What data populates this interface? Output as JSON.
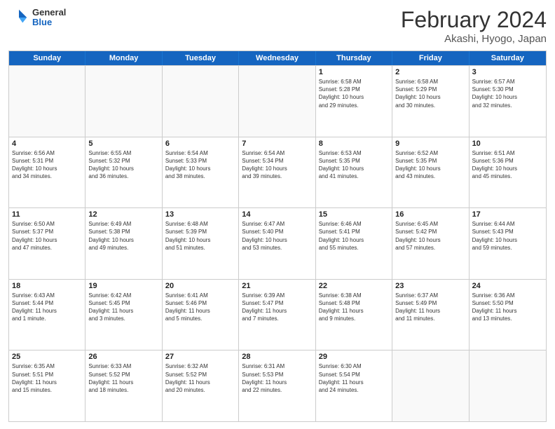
{
  "header": {
    "logo": {
      "general": "General",
      "blue": "Blue"
    },
    "title": "February 2024",
    "location": "Akashi, Hyogo, Japan"
  },
  "days_of_week": [
    "Sunday",
    "Monday",
    "Tuesday",
    "Wednesday",
    "Thursday",
    "Friday",
    "Saturday"
  ],
  "rows": [
    {
      "cells": [
        {
          "day": "",
          "info": ""
        },
        {
          "day": "",
          "info": ""
        },
        {
          "day": "",
          "info": ""
        },
        {
          "day": "",
          "info": ""
        },
        {
          "day": "1",
          "info": "Sunrise: 6:58 AM\nSunset: 5:28 PM\nDaylight: 10 hours\nand 29 minutes."
        },
        {
          "day": "2",
          "info": "Sunrise: 6:58 AM\nSunset: 5:29 PM\nDaylight: 10 hours\nand 30 minutes."
        },
        {
          "day": "3",
          "info": "Sunrise: 6:57 AM\nSunset: 5:30 PM\nDaylight: 10 hours\nand 32 minutes."
        }
      ]
    },
    {
      "cells": [
        {
          "day": "4",
          "info": "Sunrise: 6:56 AM\nSunset: 5:31 PM\nDaylight: 10 hours\nand 34 minutes."
        },
        {
          "day": "5",
          "info": "Sunrise: 6:55 AM\nSunset: 5:32 PM\nDaylight: 10 hours\nand 36 minutes."
        },
        {
          "day": "6",
          "info": "Sunrise: 6:54 AM\nSunset: 5:33 PM\nDaylight: 10 hours\nand 38 minutes."
        },
        {
          "day": "7",
          "info": "Sunrise: 6:54 AM\nSunset: 5:34 PM\nDaylight: 10 hours\nand 39 minutes."
        },
        {
          "day": "8",
          "info": "Sunrise: 6:53 AM\nSunset: 5:35 PM\nDaylight: 10 hours\nand 41 minutes."
        },
        {
          "day": "9",
          "info": "Sunrise: 6:52 AM\nSunset: 5:35 PM\nDaylight: 10 hours\nand 43 minutes."
        },
        {
          "day": "10",
          "info": "Sunrise: 6:51 AM\nSunset: 5:36 PM\nDaylight: 10 hours\nand 45 minutes."
        }
      ]
    },
    {
      "cells": [
        {
          "day": "11",
          "info": "Sunrise: 6:50 AM\nSunset: 5:37 PM\nDaylight: 10 hours\nand 47 minutes."
        },
        {
          "day": "12",
          "info": "Sunrise: 6:49 AM\nSunset: 5:38 PM\nDaylight: 10 hours\nand 49 minutes."
        },
        {
          "day": "13",
          "info": "Sunrise: 6:48 AM\nSunset: 5:39 PM\nDaylight: 10 hours\nand 51 minutes."
        },
        {
          "day": "14",
          "info": "Sunrise: 6:47 AM\nSunset: 5:40 PM\nDaylight: 10 hours\nand 53 minutes."
        },
        {
          "day": "15",
          "info": "Sunrise: 6:46 AM\nSunset: 5:41 PM\nDaylight: 10 hours\nand 55 minutes."
        },
        {
          "day": "16",
          "info": "Sunrise: 6:45 AM\nSunset: 5:42 PM\nDaylight: 10 hours\nand 57 minutes."
        },
        {
          "day": "17",
          "info": "Sunrise: 6:44 AM\nSunset: 5:43 PM\nDaylight: 10 hours\nand 59 minutes."
        }
      ]
    },
    {
      "cells": [
        {
          "day": "18",
          "info": "Sunrise: 6:43 AM\nSunset: 5:44 PM\nDaylight: 11 hours\nand 1 minute."
        },
        {
          "day": "19",
          "info": "Sunrise: 6:42 AM\nSunset: 5:45 PM\nDaylight: 11 hours\nand 3 minutes."
        },
        {
          "day": "20",
          "info": "Sunrise: 6:41 AM\nSunset: 5:46 PM\nDaylight: 11 hours\nand 5 minutes."
        },
        {
          "day": "21",
          "info": "Sunrise: 6:39 AM\nSunset: 5:47 PM\nDaylight: 11 hours\nand 7 minutes."
        },
        {
          "day": "22",
          "info": "Sunrise: 6:38 AM\nSunset: 5:48 PM\nDaylight: 11 hours\nand 9 minutes."
        },
        {
          "day": "23",
          "info": "Sunrise: 6:37 AM\nSunset: 5:49 PM\nDaylight: 11 hours\nand 11 minutes."
        },
        {
          "day": "24",
          "info": "Sunrise: 6:36 AM\nSunset: 5:50 PM\nDaylight: 11 hours\nand 13 minutes."
        }
      ]
    },
    {
      "cells": [
        {
          "day": "25",
          "info": "Sunrise: 6:35 AM\nSunset: 5:51 PM\nDaylight: 11 hours\nand 15 minutes."
        },
        {
          "day": "26",
          "info": "Sunrise: 6:33 AM\nSunset: 5:52 PM\nDaylight: 11 hours\nand 18 minutes."
        },
        {
          "day": "27",
          "info": "Sunrise: 6:32 AM\nSunset: 5:52 PM\nDaylight: 11 hours\nand 20 minutes."
        },
        {
          "day": "28",
          "info": "Sunrise: 6:31 AM\nSunset: 5:53 PM\nDaylight: 11 hours\nand 22 minutes."
        },
        {
          "day": "29",
          "info": "Sunrise: 6:30 AM\nSunset: 5:54 PM\nDaylight: 11 hours\nand 24 minutes."
        },
        {
          "day": "",
          "info": ""
        },
        {
          "day": "",
          "info": ""
        }
      ]
    }
  ]
}
